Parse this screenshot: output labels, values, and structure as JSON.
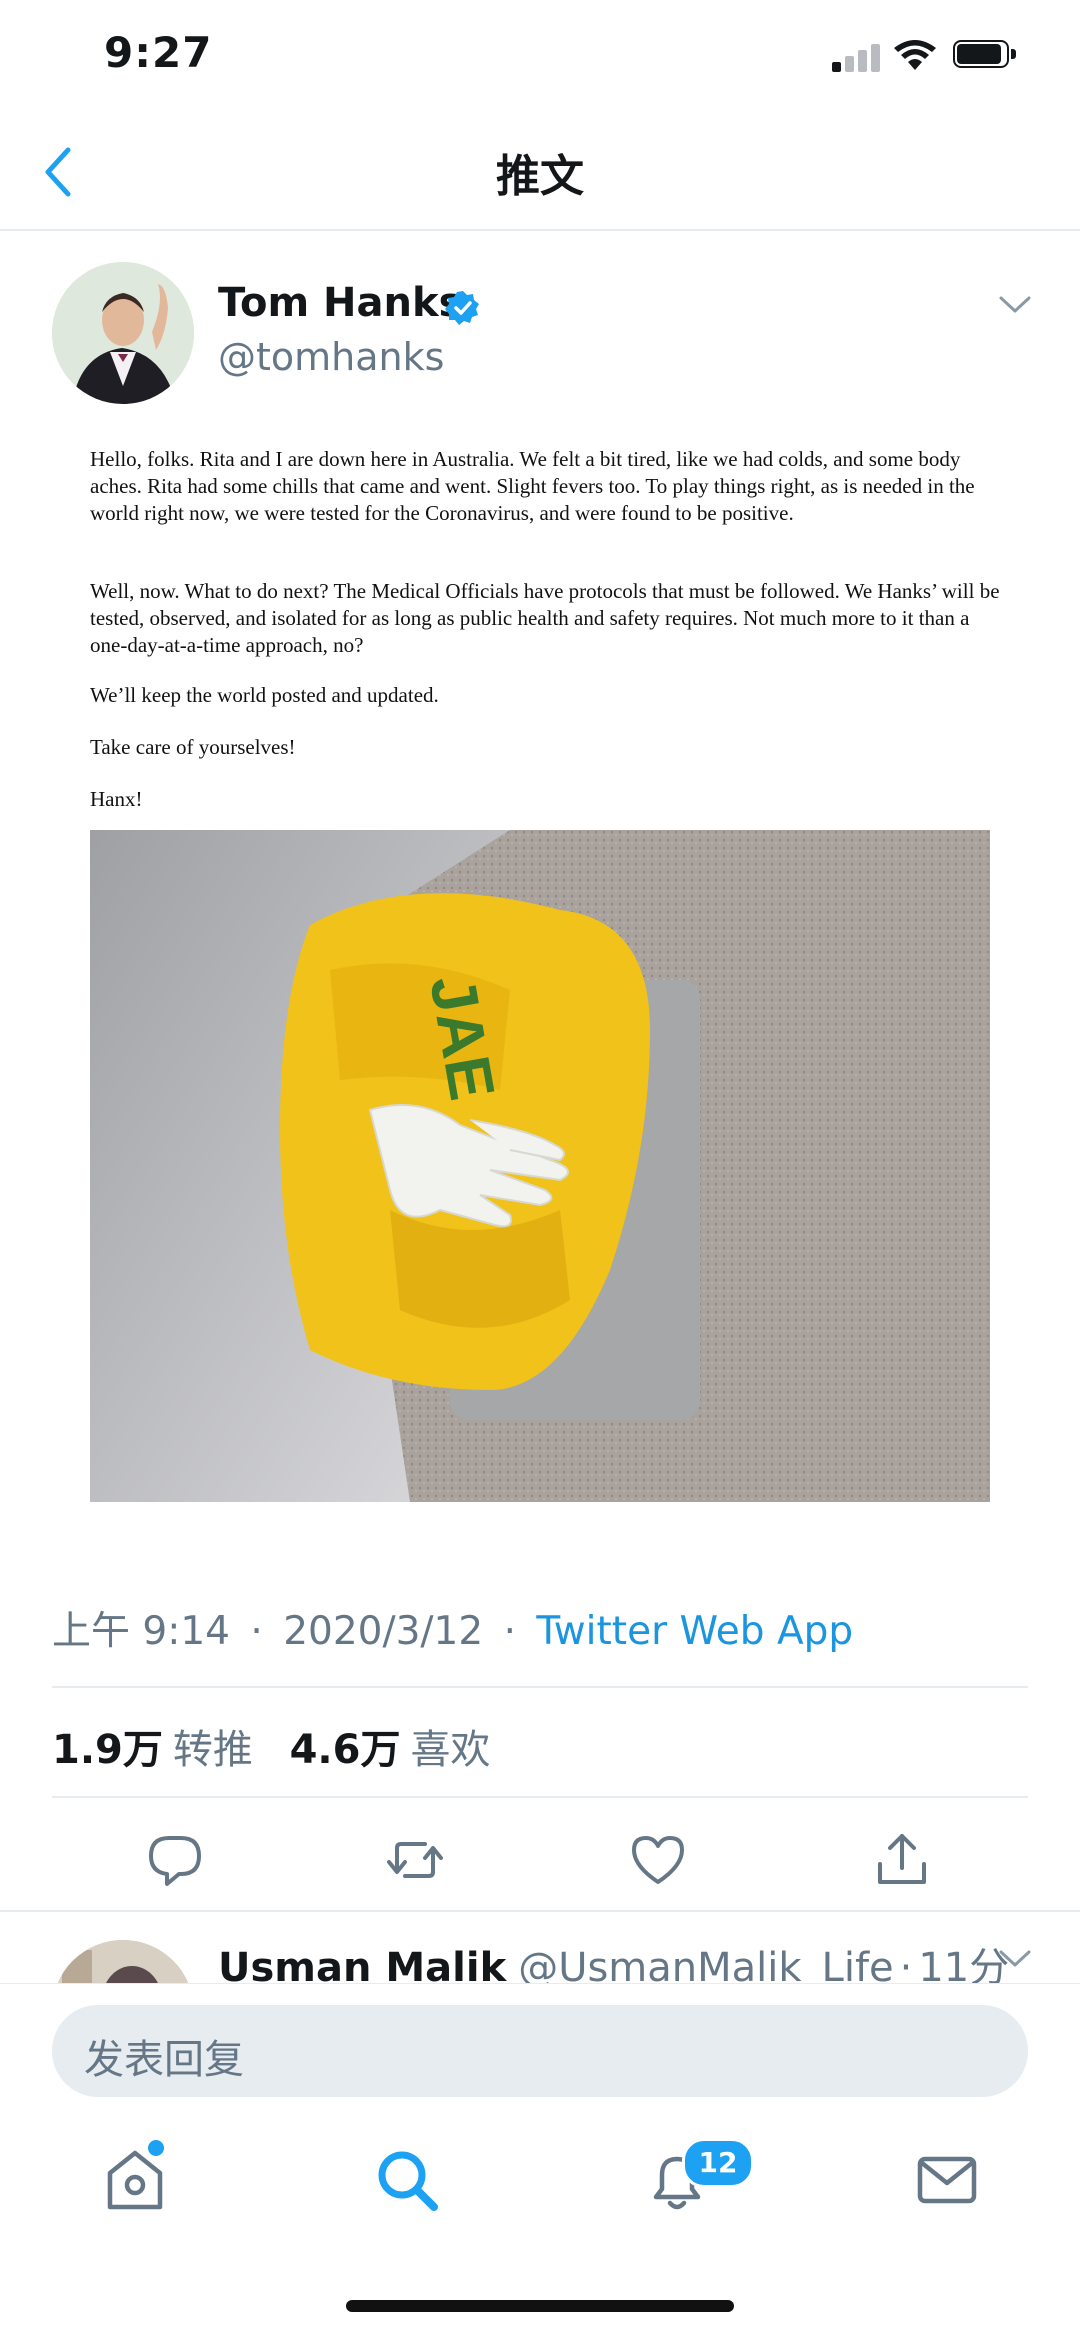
{
  "status_bar": {
    "time": "9:27"
  },
  "nav": {
    "title": "推文",
    "back_icon": "chevron-left-icon"
  },
  "tweet": {
    "author_name": "Tom Hanks",
    "author_handle": "@tomhanks",
    "image_text": {
      "p1": "Hello, folks. Rita and I are down here in Australia. We felt a bit tired, like we had colds, and some body aches. Rita had some chills that came and went. Slight fevers too. To play things right, as is needed in the world right now, we were tested for the Coronavirus, and were found to be positive.",
      "p2": "Well, now. What to do next? The Medical Officials have protocols that must be followed. We Hanks’ will be tested, observed, and isolated for as long as public health and safety requires.  Not much more to it than a one-day-at-a-time approach, no?",
      "p3": "We’ll keep the world posted and updated.",
      "p4": "Take care of yourselves!",
      "p5": "Hanx!"
    },
    "time": "上午 9:14",
    "date": "2020/3/12",
    "separator": "·",
    "source": "Twitter Web App",
    "retweets_count": "1.9万",
    "retweets_label": "转推",
    "likes_count": "4.6万",
    "likes_label": "喜欢"
  },
  "reply_preview": {
    "name": "Usman Malik",
    "handle": "@UsmanMalik_Life",
    "time": "11分"
  },
  "composer": {
    "placeholder": "发表回复"
  },
  "tabbar": {
    "notifications_badge": "12"
  },
  "colors": {
    "accent": "#1da1f2",
    "link": "#1b95e0",
    "secondary_text": "#657786"
  }
}
